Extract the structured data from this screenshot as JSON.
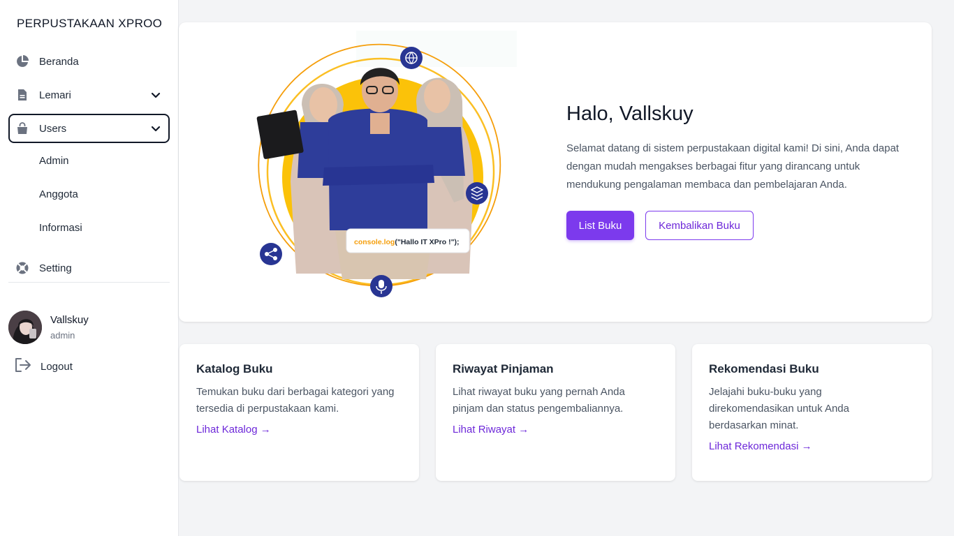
{
  "app": {
    "brand": "PERPUSTAKAAN XPROO"
  },
  "sidebar": {
    "items": [
      {
        "label": "Beranda",
        "icon": "pie-chart-icon"
      },
      {
        "label": "Lemari",
        "icon": "document-icon"
      },
      {
        "label": "Users",
        "icon": "bag-icon"
      },
      {
        "label": "Setting",
        "icon": "lifebuoy-icon"
      }
    ],
    "users_sub": [
      "Admin",
      "Anggota",
      "Informasi"
    ]
  },
  "user": {
    "name": "Vallskuy",
    "role": "admin"
  },
  "logout_label": "Logout",
  "hero": {
    "title": "Halo, Vallskuy",
    "text": "Selamat datang di sistem perpustakaan digital kami! Di sini, Anda dapat dengan mudah mengakses berbagai fitur yang dirancang untuk mendukung pengalaman membaca dan pembelajaran Anda.",
    "primary_button": "List Buku",
    "secondary_button": "Kembalikan Buku",
    "image_code_text_fn": "console.log",
    "image_code_text_arg": "(\"Hallo IT XPro !\");"
  },
  "cards": [
    {
      "title": "Katalog Buku",
      "text": "Temukan buku dari berbagai kategori yang tersedia di perpustakaan kami.",
      "link": "Lihat Katalog →"
    },
    {
      "title": "Riwayat Pinjaman",
      "text": "Lihat riwayat buku yang pernah Anda pinjam dan status pengembaliannya.",
      "link": "Lihat Riwayat →"
    },
    {
      "title": "Rekomendasi Buku",
      "text": "Jelajahi buku-buku yang direkomendasikan untuk Anda berdasarkan minat.",
      "link": "Lihat Rekomendasi →"
    }
  ],
  "colors": {
    "accent": "#7c3aed",
    "sidebar_bg": "#ffffff",
    "page_bg": "#f3f4f6",
    "hero_circle": "#fbbf24",
    "badge_blue": "#283593"
  }
}
